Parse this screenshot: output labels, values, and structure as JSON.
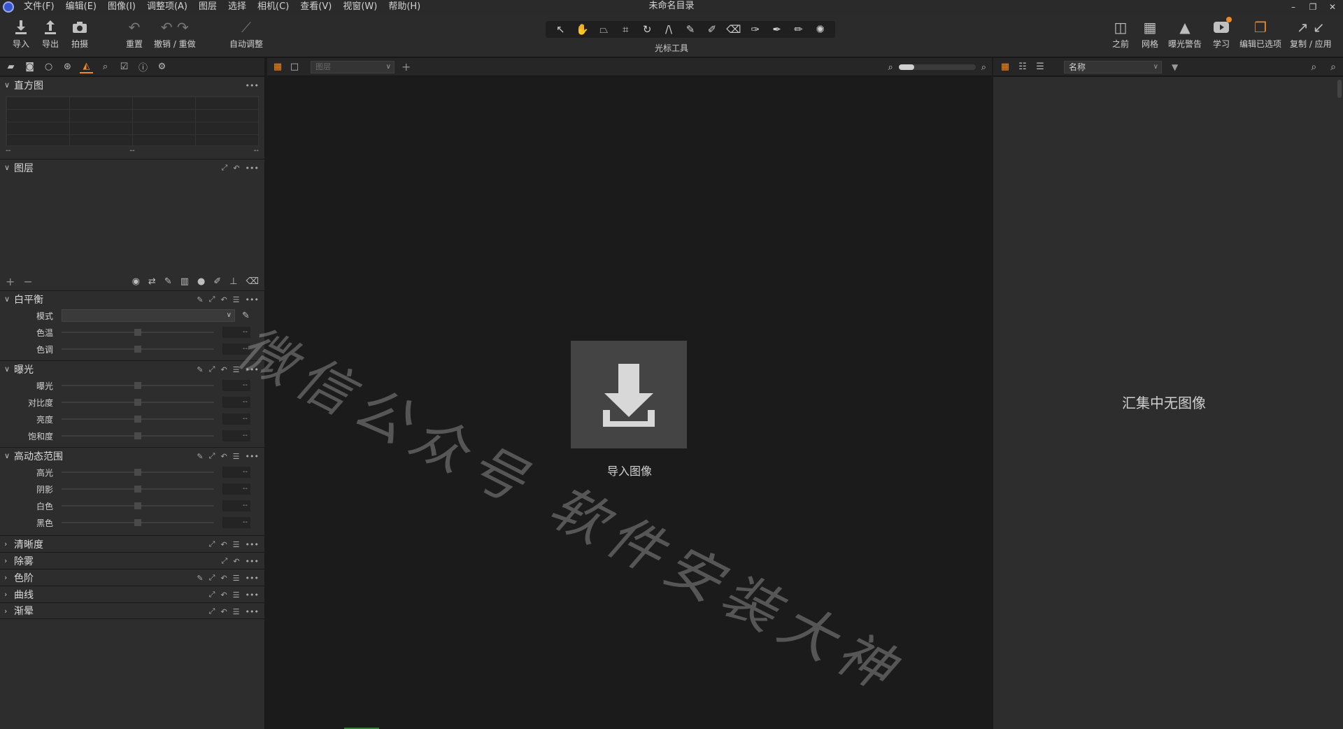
{
  "window": {
    "title": "未命名目录",
    "controls": [
      "–",
      "❐",
      "✕"
    ]
  },
  "menu": [
    "文件(F)",
    "编辑(E)",
    "图像(I)",
    "调整项(A)",
    "图层",
    "选择",
    "相机(C)",
    "查看(V)",
    "视窗(W)",
    "帮助(H)"
  ],
  "toolbar": {
    "import": "导入",
    "export": "导出",
    "capture": "拍摄",
    "reset": "重置",
    "undo_redo": "撤销 / 重做",
    "auto_adjust": "自动调整",
    "cursor_tools": "光标工具",
    "before": "之前",
    "grid": "网格",
    "exposure_warning": "曝光警告",
    "learn": "学习",
    "edit_selected": "编辑已选项",
    "copy_apply": "复制 / 应用"
  },
  "left_panel": {
    "histogram": {
      "title": "直方图",
      "values": [
        "--",
        "--",
        "--"
      ]
    },
    "layers": {
      "title": "图层"
    },
    "white_balance": {
      "title": "白平衡",
      "mode_label": "模式",
      "mode_value": "",
      "params": [
        {
          "label": "色温",
          "value": "--"
        },
        {
          "label": "色调",
          "value": "--"
        }
      ]
    },
    "exposure": {
      "title": "曝光",
      "params": [
        {
          "label": "曝光",
          "value": "--"
        },
        {
          "label": "对比度",
          "value": "--"
        },
        {
          "label": "亮度",
          "value": "--"
        },
        {
          "label": "饱和度",
          "value": "--"
        }
      ]
    },
    "hdr": {
      "title": "高动态范围",
      "params": [
        {
          "label": "高光",
          "value": "--"
        },
        {
          "label": "阴影",
          "value": "--"
        },
        {
          "label": "白色",
          "value": "--"
        },
        {
          "label": "黑色",
          "value": "--"
        }
      ]
    },
    "collapsed_sections": [
      "清晰度",
      "除雾",
      "色阶",
      "曲线",
      "渐晕"
    ]
  },
  "viewer": {
    "layer_select": "图层",
    "import_label": "导入图像"
  },
  "browser": {
    "sort_select": "名称",
    "empty_message": "汇集中无图像"
  },
  "watermark": "微信公众号 软件安装大神",
  "colors": {
    "accent": "#f08a24",
    "panel": "#2d2d2d",
    "viewer": "#1b1b1b"
  }
}
